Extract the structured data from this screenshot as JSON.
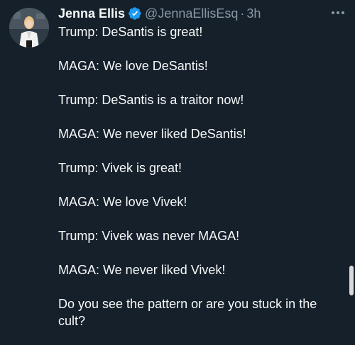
{
  "tweet": {
    "author": {
      "display_name": "Jenna Ellis",
      "handle": "@JennaEllisEsq",
      "verified_icon": "verified-badge-icon"
    },
    "separator": "·",
    "timestamp": "3h",
    "more_icon": "more-options-icon",
    "lines": [
      "Trump: DeSantis is great!",
      "MAGA: We love DeSantis!",
      "Trump: DeSantis is a traitor now!",
      "MAGA: We never liked DeSantis!",
      "Trump: Vivek is great!",
      "MAGA: We love Vivek!",
      "Trump: Vivek was never MAGA!",
      "MAGA: We never liked Vivek!",
      "Do you see the pattern or are you stuck in the cult?"
    ]
  },
  "colors": {
    "background": "#15202b",
    "primary_text": "#f7f9f9",
    "secondary_text": "#8b98a5",
    "verified_blue": "#1d9bf0"
  }
}
